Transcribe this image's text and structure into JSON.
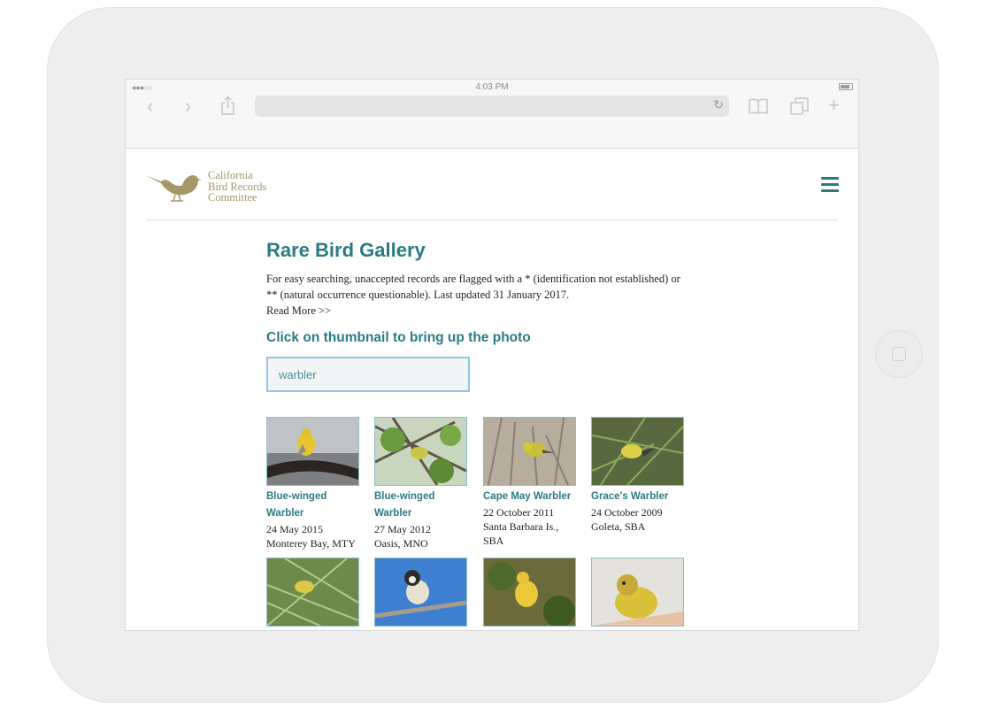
{
  "device": {
    "status_time": "4:03 PM"
  },
  "site": {
    "logo_lines": [
      "California",
      "Bird Records",
      "Committee"
    ]
  },
  "page": {
    "title": "Rare Bird Gallery",
    "intro": "For easy searching, unaccepted records are flagged with a * (identification not established) or ** (natural occurrence questionable). Last updated 31 January 2017.",
    "read_more": "Read More >>",
    "subtitle": "Click on thumbnail to bring up the photo",
    "search_value": "warbler"
  },
  "gallery": [
    {
      "name": "Blue-winged Warbler",
      "date": "24 May 2015",
      "location": "Monterey Bay, MTY"
    },
    {
      "name": "Blue-winged Warbler",
      "date": "27 May 2012",
      "location": "Oasis, MNO"
    },
    {
      "name": "Cape May Warbler",
      "date": "22 October 2011",
      "location": "Santa Barbara Is., SBA"
    },
    {
      "name": "Grace's Warbler",
      "date": "24 October 2009",
      "location": "Goleta, SBA"
    }
  ],
  "colors": {
    "accent": "#2b7b84",
    "logo": "#a59766",
    "search_border": "#8ec7e6"
  }
}
